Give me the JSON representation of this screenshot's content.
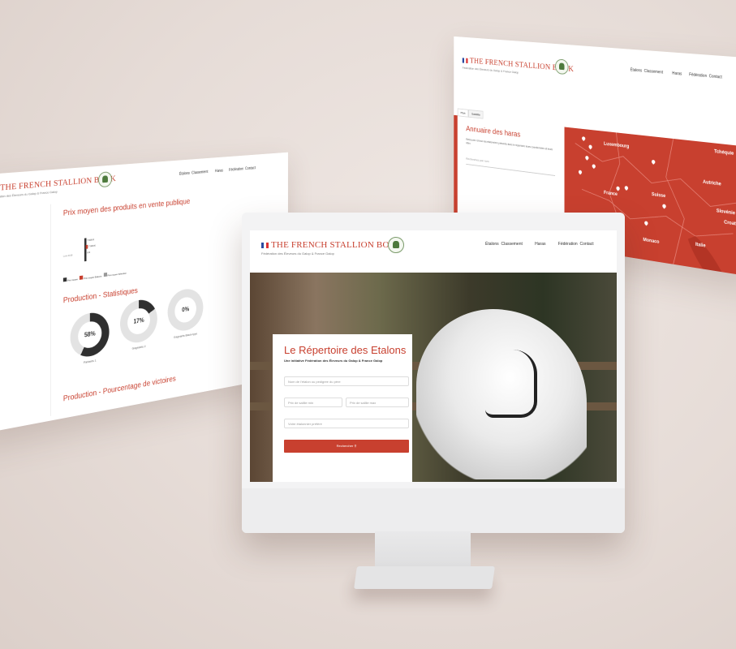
{
  "brand": {
    "name": "THE FRENCH STALLION BOOK",
    "subtitle": "Fédération des Éleveurs du Galop & France Galop"
  },
  "nav": [
    "Étalons",
    "Classement",
    "Haras",
    "Fédération",
    "Contact"
  ],
  "stats_panel": {
    "price_title": "Prix moyen des produits en vente publique",
    "price_bars": [
      "7 000 €",
      "7 000 €",
      "0 €"
    ],
    "price_row_label": "Lots 2018",
    "legend": [
      "Prix moyen",
      "Prix moyen Etalons",
      "Prix moyen Sélection"
    ],
    "production_title": "Production - Statistiques",
    "donuts": [
      {
        "value": "58%",
        "label": "Partants 1",
        "fraction": 0.58
      },
      {
        "value": "17%",
        "label": "Gagnants 2",
        "fraction": 0.17
      },
      {
        "value": "0%",
        "label": "Gagnants Black-type",
        "fraction": 0.0
      }
    ],
    "victory_title": "Production - Pourcentage de victoires"
  },
  "map_panel": {
    "tabs": [
      "Plan",
      "Satellite"
    ],
    "title": "Annuaire des haras",
    "description": "Retrouvez ici tous les étalonniers présents dans le répertoire leurs coordonnées et leurs sites",
    "search_placeholder": "Recherchez par nom",
    "countries": [
      "Luxembourg",
      "Tchéquie",
      "Autriche",
      "France",
      "Suisse",
      "Slovénie",
      "Croatie",
      "Monaco",
      "Italie"
    ]
  },
  "monitor": {
    "hero_title": "Le Répertoire des Etalons",
    "hero_subtitle": "Une initiative Fédération des Éleveurs du Galop & France Galop",
    "fields": {
      "name_placeholder": "Nom de l'étalon ou pedigree du père",
      "price_min": "Prix de saillie min",
      "price_max": "Prix de saillie max",
      "extra": "Votre étalonnier préféré"
    },
    "search_button": "Rechercher"
  },
  "colors": {
    "accent": "#c8402f",
    "background": "#e9e0db"
  }
}
